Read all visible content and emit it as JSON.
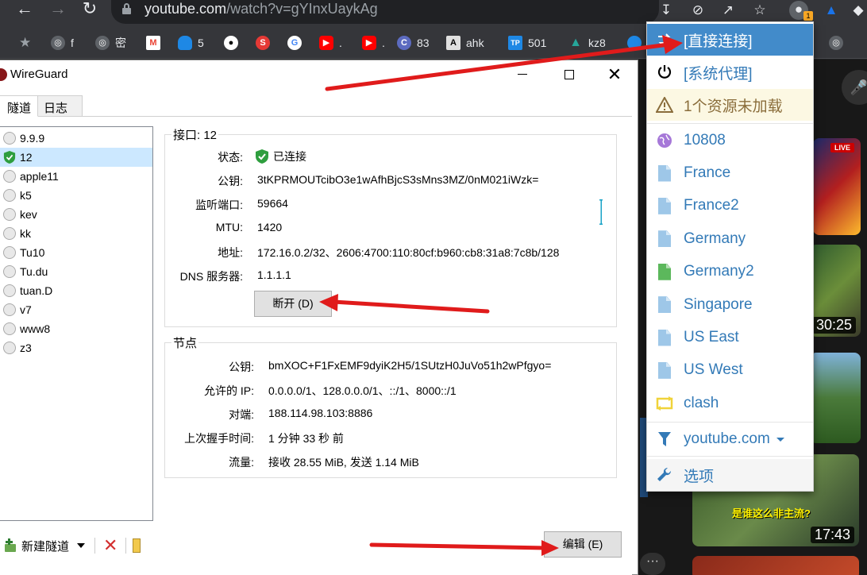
{
  "browser": {
    "url_host": "youtube.com",
    "url_path": "/watch?v=gYInxUaykAg",
    "extension_badge": "1",
    "bookmarks": [
      {
        "label": "f",
        "icon": "globe-icon",
        "color": "#9aa0a6"
      },
      {
        "label": "密",
        "icon": "globe-icon",
        "color": "#9aa0a6"
      },
      {
        "label": "",
        "icon": "gmail-icon",
        "color": "#ea4335"
      },
      {
        "label": "5",
        "icon": "onedrive-icon",
        "color": "#1e88e5"
      },
      {
        "label": "",
        "icon": "github-icon",
        "color": "#ffffff"
      },
      {
        "label": "",
        "icon": "red-app-icon",
        "color": "#e53935"
      },
      {
        "label": "",
        "icon": "google-icon",
        "color": "#4285f4"
      },
      {
        "label": ".",
        "icon": "youtube-icon",
        "color": "#ff0000"
      },
      {
        "label": ".",
        "icon": "youtube-icon",
        "color": "#ff0000"
      },
      {
        "label": "83",
        "icon": "app-c-icon",
        "color": "#5c6bc0"
      },
      {
        "label": "ahk",
        "icon": "letter-a-icon",
        "color": "#e0e0e0"
      },
      {
        "label": "501",
        "icon": "tp-icon",
        "color": "#1e88e5"
      },
      {
        "label": "kz8",
        "icon": "kz-icon",
        "color": "#26a69a"
      }
    ]
  },
  "video_page": {
    "thumbs": [
      {
        "badge": "LIVE"
      },
      {
        "time": "30:25"
      },
      {
        "time": ""
      },
      {
        "time": "17:43",
        "caption": "是谁这么非主流?"
      },
      {
        "time": ""
      }
    ]
  },
  "wireguard": {
    "title": "WireGuard",
    "tabs": [
      "隧道",
      "日志"
    ],
    "tunnels": [
      "9.9.9",
      "12",
      "apple11",
      "k5",
      "kev",
      "kk",
      "Tu10",
      "Tu.du",
      "tuan.D",
      "v7",
      "www8",
      "z3"
    ],
    "selected_tunnel_index": 1,
    "new_tunnel_label": "新建隧道",
    "interface": {
      "title": "接口: 12",
      "status_label": "状态:",
      "status_value": "已连接",
      "pubkey_label": "公钥:",
      "pubkey_value": "3tKPRMOUTcibO3e1wAfhBjcS3sMns3MZ/0nM021iWzk=",
      "port_label": "监听端口:",
      "port_value": "59664",
      "mtu_label": "MTU:",
      "mtu_value": "1420",
      "addr_label": "地址:",
      "addr_value": "172.16.0.2/32、2606:4700:110:80cf:b960:cb8:31a8:7c8b/128",
      "dns_label": "DNS 服务器:",
      "dns_value": "1.1.1.1",
      "disconnect_label": "断开 (D)"
    },
    "peer": {
      "title": "节点",
      "pubkey_label": "公钥:",
      "pubkey_value": "bmXOC+F1FxEMF9dyiK2H5/1SUtzH0JuVo51h2wPfgyo=",
      "allowed_label": "允许的 IP:",
      "allowed_value": "0.0.0.0/1、128.0.0.0/1、::/1、8000::/1",
      "endpoint_label": "对端:",
      "endpoint_value": "188.114.98.103:8886",
      "handshake_label": "上次握手时间:",
      "handshake_value": "1 分钟 33 秒 前",
      "transfer_label": "流量:",
      "transfer_value": "接收 28.55 MiB, 发送 1.14 MiB"
    },
    "edit_label": "编辑 (E)"
  },
  "proxy_menu": {
    "direct": "[直接连接]",
    "system": "[系统代理]",
    "warning": "1个资源未加载",
    "profiles": [
      "10808",
      "France",
      "France2",
      "Germany",
      "Germany2",
      "Singapore",
      "US East",
      "US West"
    ],
    "clash": "clash",
    "site": "youtube.com",
    "options": "选项"
  }
}
